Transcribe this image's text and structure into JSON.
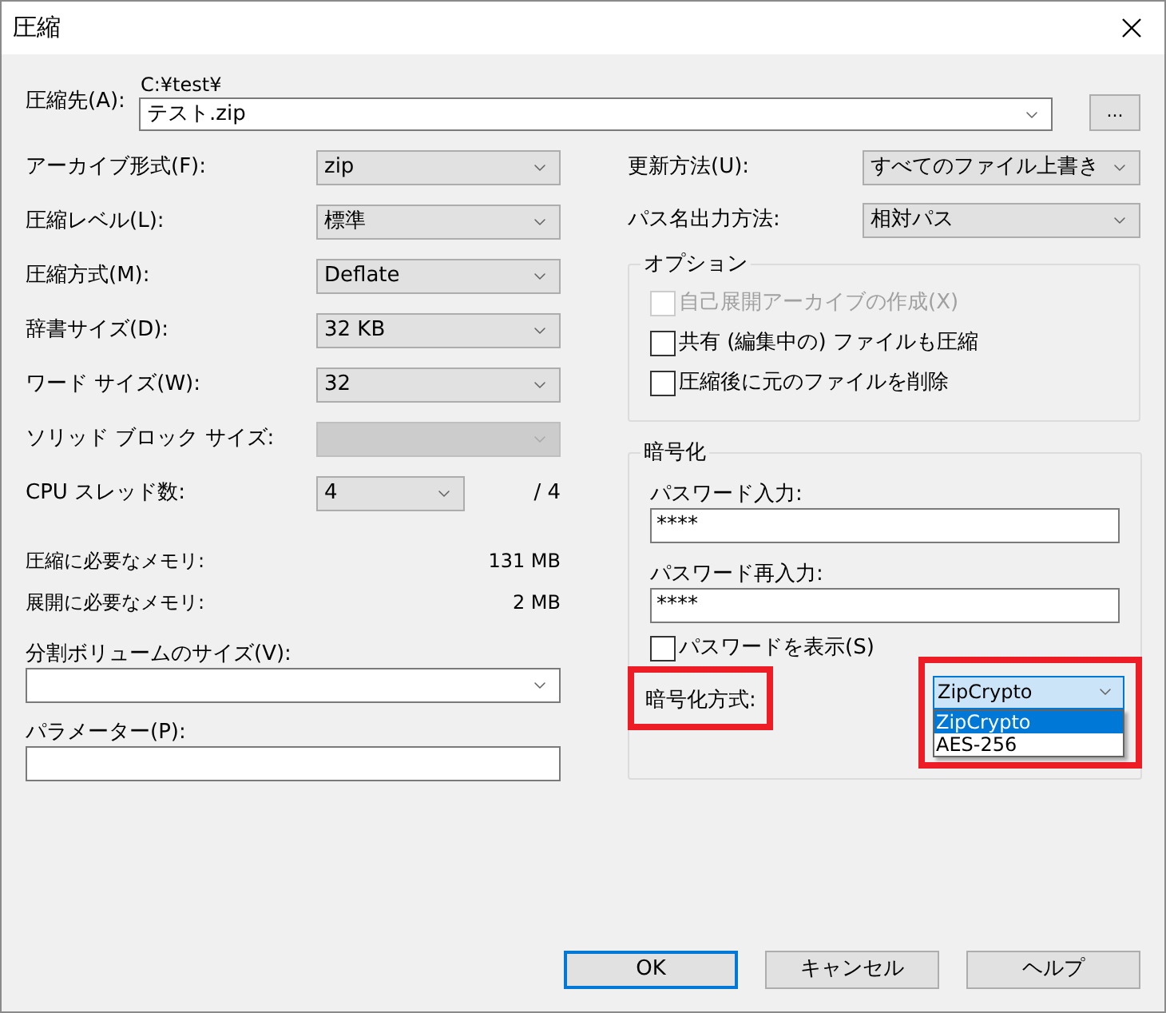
{
  "window": {
    "title": "圧縮"
  },
  "destination": {
    "label": "圧縮先(A):",
    "path": "C:¥test¥",
    "value": "テスト.zip",
    "browse": "..."
  },
  "left_fields": [
    {
      "kind": "select",
      "label": "アーカイブ形式(F):",
      "value": "zip",
      "disabled": false
    },
    {
      "kind": "select",
      "label": "圧縮レベル(L):",
      "value": "標準",
      "disabled": false
    },
    {
      "kind": "select",
      "label": "圧縮方式(M):",
      "value": "Deflate",
      "disabled": false
    },
    {
      "kind": "select",
      "label": "辞書サイズ(D):",
      "value": "32 KB",
      "disabled": false
    },
    {
      "kind": "select",
      "label": "ワード サイズ(W):",
      "value": "32",
      "disabled": false
    },
    {
      "kind": "select",
      "label": "ソリッド ブロック サイズ:",
      "disabled": true
    },
    {
      "kind": "threads",
      "label": "CPU スレッド数:",
      "value": "4",
      "max": "/ 4",
      "disabled": false
    }
  ],
  "memory": [
    {
      "label": "圧縮に必要なメモリ:",
      "value": "131 MB"
    },
    {
      "label": "展開に必要なメモリ:",
      "value": "2 MB"
    }
  ],
  "split_volume": {
    "label": "分割ボリュームのサイズ(V):"
  },
  "parameters": {
    "label": "パラメーター(P):"
  },
  "right_fields": [
    {
      "label": "更新方法(U):",
      "value": "すべてのファイル上書き"
    },
    {
      "label": "パス名出力方法:",
      "value": "相対パス"
    }
  ],
  "options": {
    "title": "オプション",
    "items": [
      {
        "label": "自己展開アーカイブの作成(X)",
        "checked": false,
        "disabled": true
      },
      {
        "label": "共有 (編集中の) ファイルも圧縮",
        "checked": false,
        "disabled": false
      },
      {
        "label": "圧縮後に元のファイルを削除",
        "checked": false,
        "disabled": false
      }
    ]
  },
  "encryption": {
    "title": "暗号化",
    "password_label": "パスワード入力:",
    "password": "****",
    "confirm_label": "パスワード再入力:",
    "confirm": "****",
    "show_password": {
      "label": "パスワードを表示(S)",
      "checked": false
    },
    "method_label": {
      "text": "暗号化方式:",
      "highlighted": true
    },
    "method": {
      "value": "ZipCrypto",
      "highlighted": true,
      "expanded": true,
      "options": [
        {
          "label": "ZipCrypto",
          "selected": true
        },
        {
          "label": "AES-256",
          "selected": false
        }
      ]
    }
  },
  "buttons": [
    {
      "label": "OK",
      "default": true
    },
    {
      "label": "キャンセル",
      "default": false
    },
    {
      "label": "ヘルプ",
      "default": false
    }
  ]
}
